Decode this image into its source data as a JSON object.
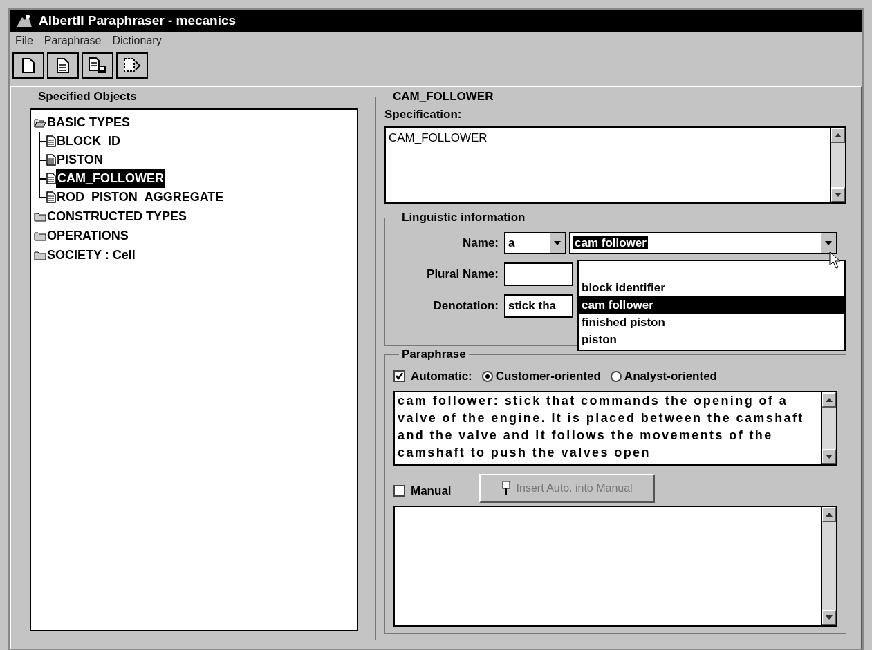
{
  "window": {
    "title": "AlbertII Paraphraser - mecanics"
  },
  "menu": [
    {
      "label": "File"
    },
    {
      "label": "Paraphrase"
    },
    {
      "label": "Dictionary"
    }
  ],
  "toolbar": [
    {
      "kind": "new"
    },
    {
      "kind": "page"
    },
    {
      "kind": "save"
    },
    {
      "kind": "export"
    }
  ],
  "tree": {
    "title": "Specified Objects",
    "items": [
      {
        "label": "BASIC TYPES",
        "expanded": true,
        "selected": false,
        "children": [
          {
            "label": "BLOCK_ID",
            "selected": false
          },
          {
            "label": "PISTON",
            "selected": false
          },
          {
            "label": "CAM_FOLLOWER",
            "selected": true
          },
          {
            "label": "ROD_PISTON_AGGREGATE",
            "selected": false
          }
        ]
      },
      {
        "label": "CONSTRUCTED TYPES",
        "expanded": false,
        "selected": false
      },
      {
        "label": "OPERATIONS",
        "expanded": false,
        "selected": false
      },
      {
        "label": "SOCIETY : Cell",
        "expanded": false,
        "selected": false
      }
    ]
  },
  "detail": {
    "title": "CAM_FOLLOWER",
    "specification": {
      "label": "Specification:",
      "value": "CAM_FOLLOWER"
    },
    "linguistic": {
      "title": "Linguistic information",
      "name": {
        "label": "Name:",
        "article": "a",
        "value": "cam follower"
      },
      "plural_name": {
        "label": "Plural Name:"
      },
      "denotation": {
        "label": "Denotation:",
        "value": "stick tha"
      },
      "dropdown": {
        "items": [
          {
            "label": "block identifier",
            "selected": false
          },
          {
            "label": "cam follower",
            "selected": true
          },
          {
            "label": "finished piston",
            "selected": false
          },
          {
            "label": "piston",
            "selected": false
          }
        ]
      }
    },
    "paraphrase": {
      "title": "Paraphrase",
      "automatic": {
        "label": "Automatic:",
        "checked": true
      },
      "options": [
        {
          "label": "Customer-oriented",
          "selected": true
        },
        {
          "label": "Analyst-oriented",
          "selected": false
        }
      ],
      "text": "cam follower: stick that commands the opening of a valve of the engine. It is placed between the camshaft and the valve and it follows the movements of the camshaft to push the valves open",
      "manual": {
        "label": "Manual",
        "checked": false
      },
      "insert_button": {
        "label": "Insert Auto. into Manual",
        "disabled": true
      }
    }
  }
}
